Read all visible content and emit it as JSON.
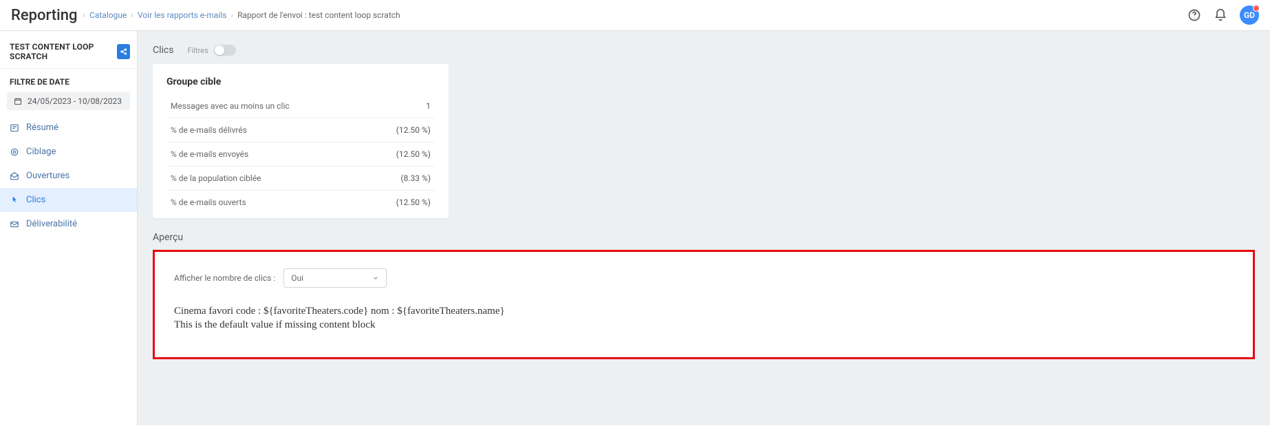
{
  "header": {
    "title": "Reporting",
    "crumbs": [
      "Catalogue",
      "Voir les rapports e-mails",
      "Rapport de l'envoi : test content loop scratch"
    ],
    "avatar": "GD"
  },
  "sidebar": {
    "title": "TEST CONTENT LOOP SCRATCH",
    "date_filter_label": "FILTRE DE DATE",
    "date_range": "24/05/2023 - 10/08/2023",
    "nav": [
      {
        "label": "Résumé"
      },
      {
        "label": "Ciblage"
      },
      {
        "label": "Ouvertures"
      },
      {
        "label": "Clics"
      },
      {
        "label": "Déliverabilité"
      }
    ]
  },
  "main": {
    "section_title": "Clics",
    "filters_label": "Filtres",
    "card": {
      "title": "Groupe cible",
      "rows": [
        {
          "label": "Messages avec au moins un clic",
          "value": "1"
        },
        {
          "label": "% de e-mails délivrés",
          "value": "(12.50 %)"
        },
        {
          "label": "% de e-mails envoyés",
          "value": "(12.50 %)"
        },
        {
          "label": "% de la population ciblée",
          "value": "(8.33 %)"
        },
        {
          "label": "% de e-mails ouverts",
          "value": "(12.50 %)"
        }
      ]
    },
    "preview_title": "Aperçu",
    "preview": {
      "show_clicks_label": "Afficher le nombre de clics :",
      "show_clicks_value": "Oui",
      "line1": "Cinema favori code : ${favoriteTheaters.code} nom : ${favoriteTheaters.name}",
      "line2": "This is the default value if missing content block"
    }
  }
}
